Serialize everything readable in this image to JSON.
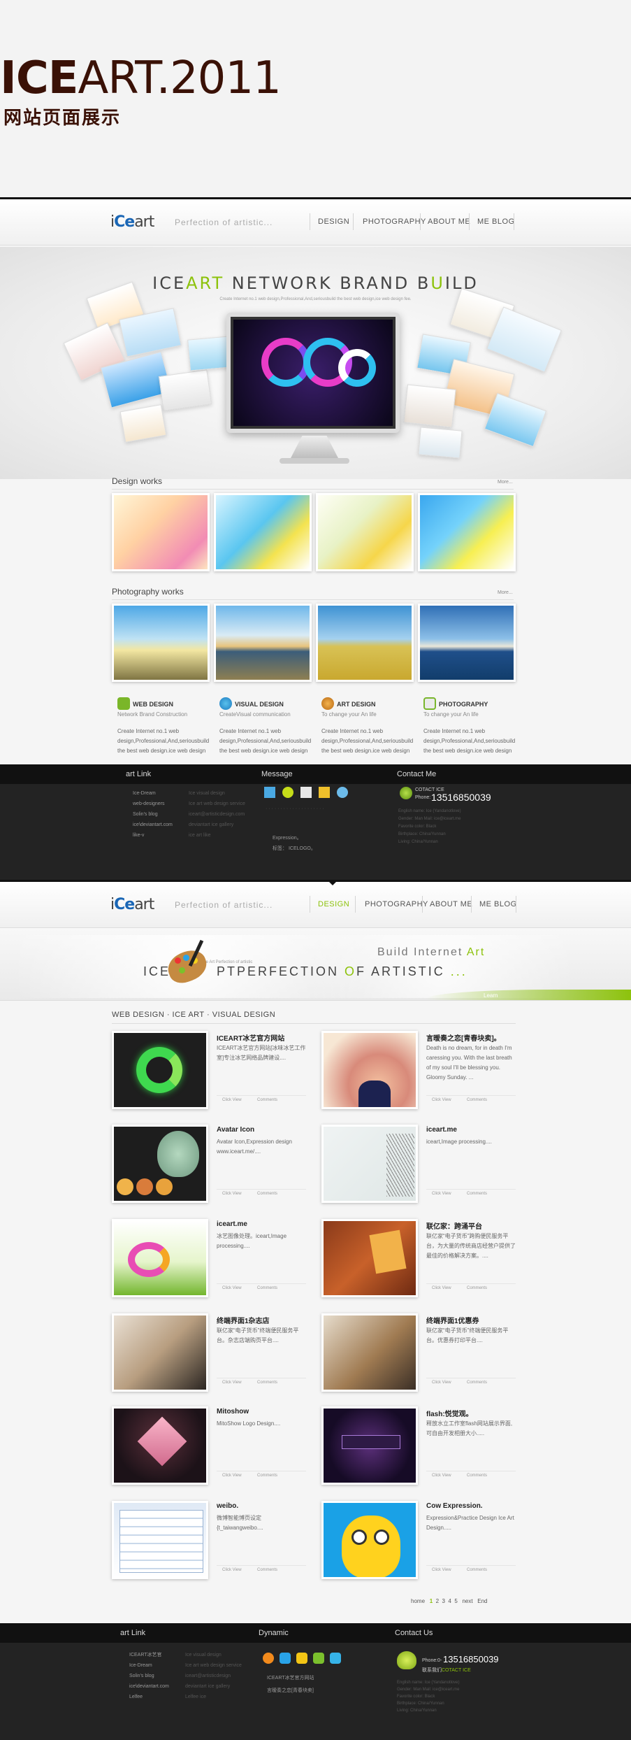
{
  "title": {
    "bold": "ICE",
    "light": "ART.2011",
    "subtitle": "网站页面展示"
  },
  "page1": {
    "logo": {
      "prefix": "i",
      "brand": "Ce",
      "suffix": "art"
    },
    "tagline": "Perfection  of  artistic...",
    "nav": [
      "DESIGN",
      "PHOTOGRAPHY",
      "ABOUT ME",
      "ME BLOG"
    ],
    "hero": {
      "title_a": "ICE",
      "title_b": "ART",
      "title_c": " NETWORK BRAND B",
      "title_d": "U",
      "title_e": "ILD",
      "sub": "Create Internet no.1 web design,Professional,And,seriousbuild the best web design,ice web design fee."
    },
    "design": {
      "title": "Design works",
      "more": "More..."
    },
    "photo": {
      "title": "Photography works",
      "more": "More..."
    },
    "features": [
      {
        "title": "WEB DESIGN",
        "sub": "Network  Brand  Construction",
        "body": "Create Internet no.1 web design,Professional,And,seriousbuild the best web design.ice web design"
      },
      {
        "title": "VISUAL DESIGN",
        "sub": "CreateVisual  communication",
        "body": "Create Internet no.1 web design,Professional,And,seriousbuild the best web design.ice web design"
      },
      {
        "title": "ART DESIGN",
        "sub": "To  change  your  An  life",
        "body": "Create Internet no.1 web design,Professional,And,seriousbuild the best web design.ice web design"
      },
      {
        "title": "PHOTOGRAPHY",
        "sub": "To  change  your  An  life",
        "body": "Create Internet no.1 web design,Professional,And,seriousbuild the best web design.ice web design"
      }
    ],
    "footer": {
      "links_title": "art Link",
      "links": [
        "Ice-Dream",
        "web-designers",
        "Solin's blog",
        "ice\\deviantart.com",
        "like-v"
      ],
      "links_dim": [
        "Ice visual design",
        "Ice art web design service",
        "iceart@artisticdesign.com",
        "deviantart ice gallery",
        "ice art like"
      ],
      "message_title": "Message",
      "message_lines": [
        "Expression。",
        "标签：  ICELOGO。"
      ],
      "contact_title": "Contact Me",
      "contact_label": "COTACT ICE",
      "phone_label": "Phone:",
      "phone": "13516850039",
      "contact_lines": [
        "English name: Ice (Yandanotlove)",
        "Gender: Man      Mail: ice@iceart.me",
        "Favorite color: Black",
        "Birthplace: China/Yunnan",
        "Living: China/Yunnan"
      ]
    }
  },
  "page2": {
    "logo": {
      "prefix": "i",
      "brand": "Ce",
      "suffix": "art"
    },
    "tagline": "Perfection  of  artistic...",
    "nav": [
      "DESIGN",
      "PHOTOGRAPHY",
      "ABOUT ME",
      "ME BLOG"
    ],
    "hero": {
      "build_a": "Build  Internet  ",
      "build_b": "Art",
      "main_a": "ICE ",
      "main_b": "PTPERFECTION ",
      "main_c": "O",
      "main_d": "F ARTISTIC",
      "small": "Ice Art Perfection of artistic",
      "learn": "Learn"
    },
    "crumbs": "WEB DESIGN  ·  ICE ART  ·  VISUAL DESIGN",
    "items": [
      {
        "title": "ICEART冰艺官方网站",
        "desc": "ICEART冰艺官方网站[冰味冰艺工作室]专注冰艺网络品牌建设...."
      },
      {
        "title": "言暧奏之恋[青春块卖]。",
        "desc": "Death is no dream, for in death I'm caressing you. With the last breath of my soul I'll be blessing you. Gloomy Sunday. ..."
      },
      {
        "title": "Avatar Icon",
        "desc": "Avatar Icon,Expression design www.iceart.me/...."
      },
      {
        "title": "iceart.me",
        "desc": "iceart,Image processing...."
      },
      {
        "title": "iceart.me",
        "desc": "冰艺图像处理。iceart,Image processing...."
      },
      {
        "title": "联亿家：跨涌平台",
        "desc": "联亿家“电子货币”跨购便民服务平台，为大量的传统商店经营户提供了最佳的价格解决方案。...."
      },
      {
        "title": "终端界面1杂志店",
        "desc": "联亿家“电子货币”终端便民服务平台。杂志店端购页平台...."
      },
      {
        "title": "终端界面1优惠券",
        "desc": "联亿家“电子货币”终端便民服务平台。优惠券打印平台...."
      },
      {
        "title": "Mitoshow",
        "desc": "MitoShow Logo Design...."
      },
      {
        "title": "flash:悦觉观。",
        "desc": "释放水立工作室flash网站展示界面,可自由开发相册大小....."
      },
      {
        "title": "weibo.",
        "desc": "微博智能博页设定   {t_taiwangweibo...."
      },
      {
        "title": "Cow Expression.",
        "desc": "Expression&Practice Design Ice Art Design....."
      }
    ],
    "meta": {
      "click": "Click View",
      "comments": "Comments"
    },
    "pager": {
      "home": "home",
      "pages": [
        "1",
        "2",
        "3",
        "4",
        "5"
      ],
      "next": "next",
      "end": "End"
    },
    "footer": {
      "links_title": "art Link",
      "links": [
        "ICEART冰艺官",
        "Ice-Dream",
        "Solin's blog",
        "ice\\deviantart.com",
        "Lelfee"
      ],
      "links_dim": [
        "Ice visual design",
        "Ice art web design service",
        "iceart@artisticdesign",
        "deviantart ice gallery",
        "Lelfee ice"
      ],
      "dynamic_title": "Dynamic",
      "dynamic_lines": [
        "ICEART冰艺官方网站",
        "言暧奏之恋[青春块卖]"
      ],
      "contact_title": "Contact Us",
      "phone_label": "Phone:0-",
      "phone": "13516850039",
      "contact_sub_a": "联系我们",
      "contact_sub_b": "COTACT ICE",
      "contact_lines": [
        "English name: Ice (Yandanotlove)",
        "Gender: Man      Mail: ice@iceart.me",
        "Favorite color: Black",
        "Birthplace: China/Yunnan",
        "Living: China/Yunnan"
      ]
    }
  },
  "colors": {
    "accent_green": "#8cc20b",
    "brown": "#3a1106",
    "footer": "#232323"
  }
}
